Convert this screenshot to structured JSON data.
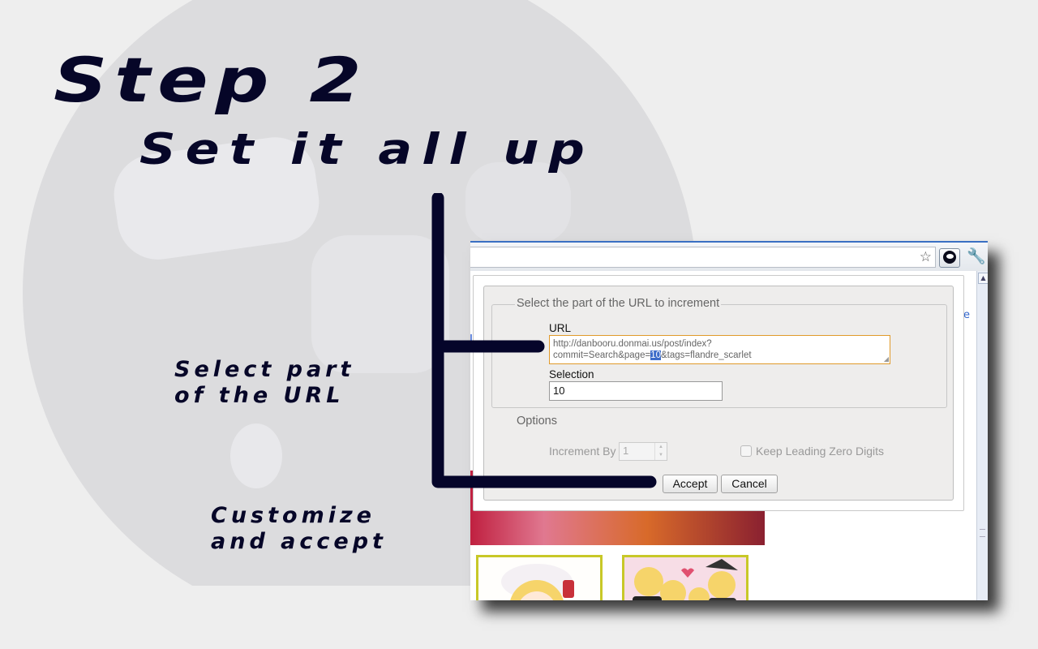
{
  "promo": {
    "title": "Step 2",
    "subtitle": "Set it all up",
    "caption_select": [
      "Select part",
      "of the URL"
    ],
    "caption_customize": [
      "Customize",
      "and accept"
    ]
  },
  "browser": {
    "omnibox_text": "",
    "partial_link": "e",
    "bookmark_icon": "star-icon",
    "extension_icon": "extension-icon",
    "menu_icon": "wrench-icon"
  },
  "dialog": {
    "legend": "Select the part of the URL to increment",
    "url_label": "URL",
    "url_before": "http://danbooru.donmai.us/post/index?commit=Search&page=",
    "url_selected": "10",
    "url_after": "&tags=flandre_scarlet",
    "selection_label": "Selection",
    "selection_value": "10",
    "options_label": "Options",
    "increment_label": "Increment By",
    "increment_value": "1",
    "leading_zero_label": "Keep Leading Zero Digits",
    "leading_zero_checked": false,
    "accept_label": "Accept",
    "cancel_label": "Cancel"
  },
  "colors": {
    "promo_text": "#060628",
    "url_highlight": "#3d6cc9",
    "url_focus_border": "#e09a2a",
    "thumbnail_border": "#c8c828"
  }
}
